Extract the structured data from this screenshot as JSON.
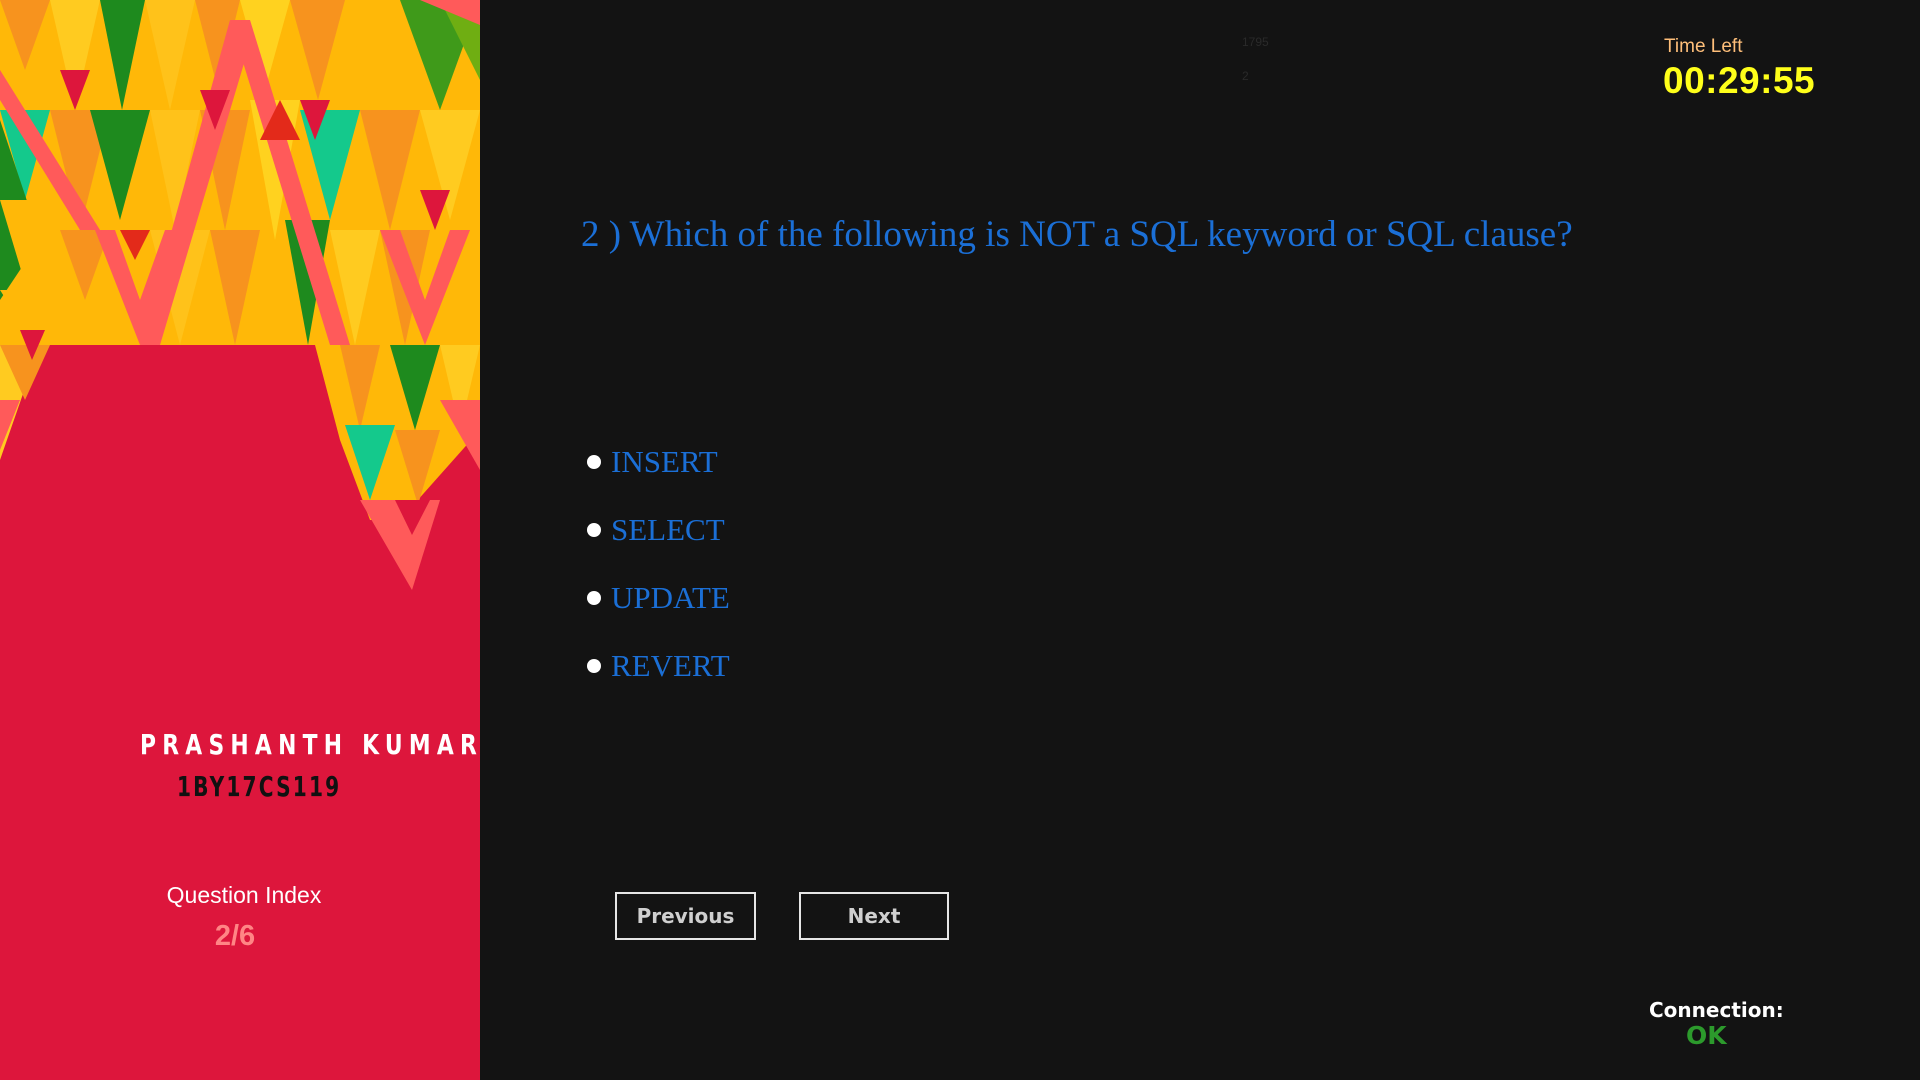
{
  "student": {
    "name": "PRASHANTH KUMAR",
    "usn": "1BY17CS119"
  },
  "question_index": {
    "label": "Question Index",
    "value": "2/6"
  },
  "debug": {
    "line1": "1795",
    "line2": "2"
  },
  "timer": {
    "label": "Time Left",
    "value": "00:29:55"
  },
  "question": {
    "text": "2 ) Which of the following is NOT a SQL keyword or SQL clause?",
    "options": [
      {
        "label": "INSERT"
      },
      {
        "label": "SELECT"
      },
      {
        "label": "UPDATE"
      },
      {
        "label": "REVERT"
      }
    ]
  },
  "navigation": {
    "previous_label": "Previous",
    "next_label": "Next"
  },
  "connection": {
    "label": "Connection:",
    "status": "OK"
  },
  "colors": {
    "panel_red": "#dd163c",
    "background": "#131313",
    "question_blue": "#1b6fd6",
    "timer_yellow": "#ffff1a",
    "timer_label_orange": "#ffbf7a",
    "index_pink": "#ff8585",
    "status_green": "#2c9a2c"
  }
}
